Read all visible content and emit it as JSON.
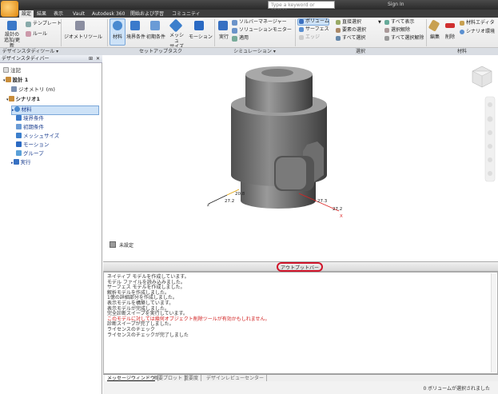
{
  "search": {
    "placeholder": "Type a keyword or phrase"
  },
  "account": {
    "sign_in": "Sign In"
  },
  "tabs": [
    "設定",
    "結果",
    "表示",
    "Vault",
    "Autodesk 360",
    "開始および学習",
    "コミュニティ"
  ],
  "ribbon": {
    "buttons": {
      "study_setup": "設計の\n追加/更新",
      "template": "テンプレート",
      "rule": "ルール",
      "geometry_tools": "ジオメトリツール",
      "materials": "材料",
      "boundary": "境界条件",
      "initial": "初期条件",
      "mesh": "メッシュ\nサイズ",
      "motion": "モーション",
      "run": "実行",
      "solver_manager": "ソルバーマネージャー",
      "solution_monitor": "ソリューションモニター",
      "apply": "適用",
      "volume": "ボリューム",
      "surface": "サーフェス",
      "edge": "エッジ",
      "select_by_wire": "直接選択",
      "select_by_flow": "要素の選択",
      "select_all": "すべて選択",
      "show_all": "すべて表示",
      "deselect": "選択解除",
      "deselect_all": "すべて選択解除",
      "edit": "編集",
      "delete": "削除",
      "material_editor": "材料エディタ",
      "scenario_env": "シナリオ環境"
    },
    "groups": [
      "デザインスタディツール",
      "セットアップタスク",
      "シミュレーション",
      "選択",
      "材料"
    ]
  },
  "design_study_bar": {
    "title": "デザインスタディバー",
    "items": [
      {
        "label": "注記"
      },
      {
        "label": "設計 1"
      },
      {
        "label": "ジオメトリ (m)"
      },
      {
        "label": "シナリオ1"
      },
      {
        "label": "材料"
      },
      {
        "label": "境界条件"
      },
      {
        "label": "初期条件"
      },
      {
        "label": "メッシュサイズ"
      },
      {
        "label": "モーション"
      },
      {
        "label": "グループ"
      },
      {
        "label": "実行"
      }
    ]
  },
  "viewport": {
    "legend_label": "未設定",
    "dimensions": [
      "20.8",
      "27.2",
      "27.3",
      "27.2"
    ],
    "axis_x": "X"
  },
  "output_bar": {
    "title": "アウトプットバー"
  },
  "messages": [
    "ネイティブ モデルを作成しています。",
    "モデル ファイルを読み込みました。",
    "サーフェス モデルを作成しました。",
    "解析モデルを作成しました。",
    "1億の詳細部分を作成しました。",
    "表示モデルを構築しています。",
    "表示モデルが完成しました。",
    "完全診断スイープを実行しています。",
    "このモデルに対しては幾何オブジェクト削除ツールが有効かもしれません。",
    "診断スイープが完了しました。",
    "ライセンスのチェック",
    "ライセンスのチェックが完了しました"
  ],
  "bottom_tabs": [
    "メッセージウィンドウ",
    "概要プロット",
    "重要度",
    "デザインレビューセンター"
  ],
  "status": {
    "text": "0 ボリュームが選択されました"
  },
  "colors": {
    "ribbon_bg": "#e9e9e9",
    "highlight": "#d0142a",
    "tree_selected": "#cde2f7",
    "warning_text": "#d01818"
  }
}
